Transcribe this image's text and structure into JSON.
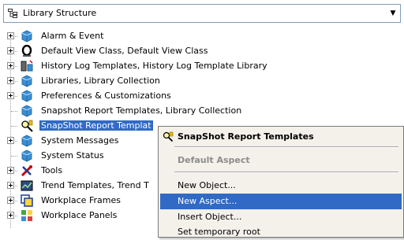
{
  "combo": {
    "title": "Library Structure",
    "icon": "tree-structure-icon"
  },
  "tree": [
    {
      "label": "Alarm & Event",
      "icon": "blue-cube-icon",
      "expandable": true
    },
    {
      "label": "Default View Class, Default View Class",
      "icon": "black-o-icon",
      "expandable": true
    },
    {
      "label": "History Log Templates, History Log Template Library",
      "icon": "history-log-icon",
      "expandable": true
    },
    {
      "label": "Libraries, Library Collection",
      "icon": "blue-cube-icon",
      "expandable": true
    },
    {
      "label": "Preferences & Customizations",
      "icon": "blue-cube-icon",
      "expandable": true
    },
    {
      "label": "Snapshot Report Templates, Library Collection",
      "icon": "blue-cube-icon",
      "expandable": false
    },
    {
      "label": "SnapShot Report Templat",
      "icon": "snapshot-report-icon",
      "expandable": false,
      "selected": true
    },
    {
      "label": "System Messages",
      "icon": "blue-cube-icon",
      "expandable": true
    },
    {
      "label": "System Status",
      "icon": "blue-cube-icon",
      "expandable": false
    },
    {
      "label": "Tools",
      "icon": "tools-icon",
      "expandable": true
    },
    {
      "label": "Trend Templates, Trend T",
      "icon": "trend-icon",
      "expandable": true
    },
    {
      "label": "Workplace Frames",
      "icon": "workplace-frames-icon",
      "expandable": true
    },
    {
      "label": "Workplace Panels",
      "icon": "workplace-panels-icon",
      "expandable": true
    }
  ],
  "context_menu": {
    "header": "SnapShot Report Templates",
    "default_aspect": "Default Aspect",
    "items": [
      "New Object...",
      "New Aspect...",
      "Insert Object...",
      "Set temporary root"
    ],
    "highlighted": "New Aspect..."
  },
  "colors": {
    "selection": "#316ac5",
    "menu_bg": "#f3f1ea",
    "cube_blue": "#3b8fd4"
  }
}
